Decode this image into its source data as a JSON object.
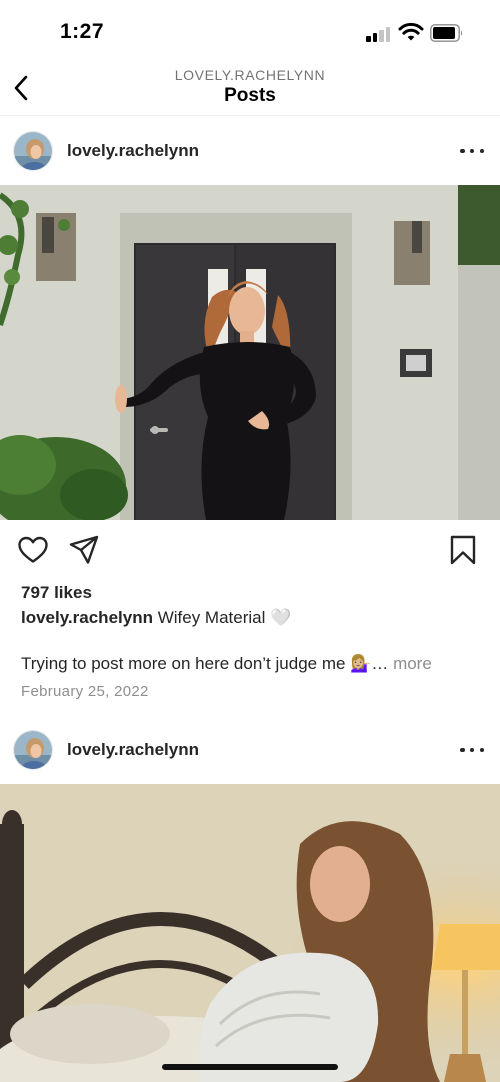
{
  "status": {
    "time": "1:27"
  },
  "nav": {
    "account": "LOVELY.RACHELYNN",
    "title": "Posts"
  },
  "posts": [
    {
      "username": "lovely.rachelynn",
      "likes": "797 likes",
      "caption_user": "lovely.rachelynn",
      "caption_text": "Wifey Material 🤍",
      "caption_line2": "Trying to post more on here don’t judge me 💁🏼‍♀️…",
      "more_label": "more",
      "date": "February 25, 2022"
    },
    {
      "username": "lovely.rachelynn"
    }
  ],
  "icons": {
    "back": "chevron-left-icon",
    "more": "more-horizontal-icon",
    "like": "heart-icon",
    "share": "paper-plane-icon",
    "save": "bookmark-icon"
  },
  "colors": {
    "text": "#262626",
    "secondary": "#8e8e8e",
    "divider": "#efefef"
  }
}
